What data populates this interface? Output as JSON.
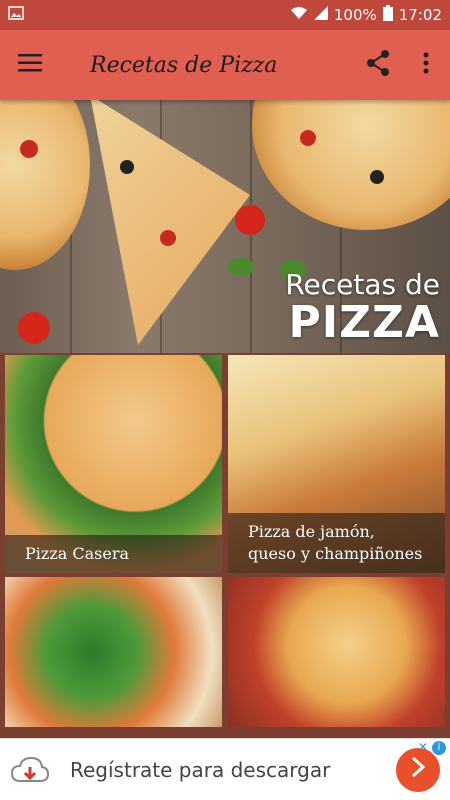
{
  "status_bar": {
    "battery": "100%",
    "time": "17:02"
  },
  "toolbar": {
    "title": "Recetas de Pizza"
  },
  "hero": {
    "subtitle": "Recetas de",
    "title": "PIZZA"
  },
  "recipes": [
    {
      "caption": "Pizza Casera"
    },
    {
      "caption": "Pizza de jamón, queso y champiñones"
    },
    {
      "caption": ""
    },
    {
      "caption": ""
    }
  ],
  "ad": {
    "text": "Regístrate para descargar",
    "info_label": "i",
    "close_label": "✕"
  },
  "colors": {
    "toolbar": "#e15f50",
    "status_bar": "#c0473c",
    "ad_button": "#e8502b"
  }
}
